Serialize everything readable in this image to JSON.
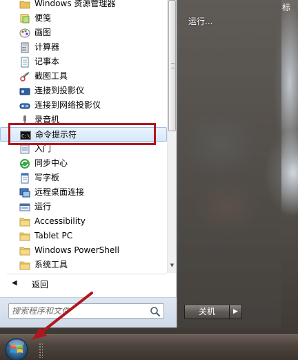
{
  "program_list": [
    {
      "label": "Windows 资源管理器",
      "icon": "folder-explorer-icon"
    },
    {
      "label": "便笺",
      "icon": "sticky-notes-icon"
    },
    {
      "label": "画图",
      "icon": "paint-icon"
    },
    {
      "label": "计算器",
      "icon": "calculator-icon"
    },
    {
      "label": "记事本",
      "icon": "notepad-icon"
    },
    {
      "label": "截图工具",
      "icon": "snipping-tool-icon"
    },
    {
      "label": "连接到投影仪",
      "icon": "projector-icon"
    },
    {
      "label": "连接到网络投影仪",
      "icon": "network-projector-icon"
    },
    {
      "label": "录音机",
      "icon": "microphone-icon"
    },
    {
      "label": "命令提示符",
      "icon": "cmd-icon"
    },
    {
      "label": "入门",
      "icon": "getting-started-icon"
    },
    {
      "label": "同步中心",
      "icon": "sync-center-icon"
    },
    {
      "label": "写字板",
      "icon": "wordpad-icon"
    },
    {
      "label": "远程桌面连接",
      "icon": "remote-desktop-icon"
    },
    {
      "label": "运行",
      "icon": "run-icon"
    },
    {
      "label": "Accessibility",
      "icon": "folder-icon"
    },
    {
      "label": "Tablet PC",
      "icon": "folder-icon"
    },
    {
      "label": "Windows PowerShell",
      "icon": "folder-icon"
    },
    {
      "label": "系统工具",
      "icon": "folder-icon"
    }
  ],
  "back_label": "返回",
  "search": {
    "placeholder": "搜索程序和文件"
  },
  "right_pane": {
    "run_label": "运行...",
    "shutdown_label": "关机",
    "shutdown_arrow": "▶"
  },
  "top_right_text": "标",
  "colors": {
    "highlight_box": "#b2161d",
    "selection": "#d6e8fa"
  }
}
